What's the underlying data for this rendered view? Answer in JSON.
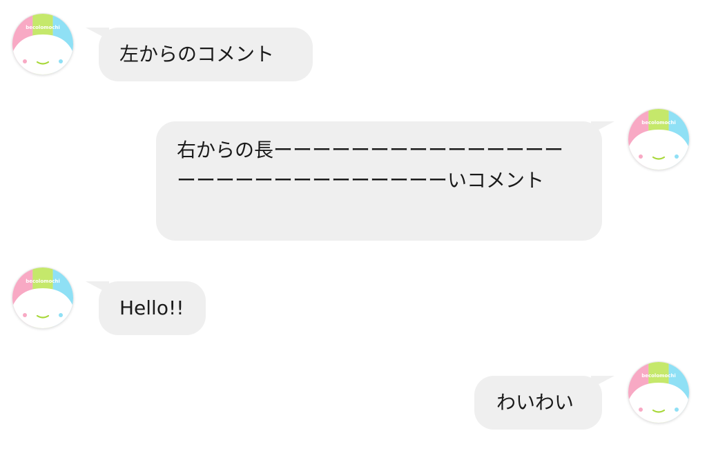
{
  "chat": {
    "avatar_text": "becolomochi",
    "avatar_icon": "becolomochi-mochi-face-icon",
    "colors": {
      "bubble": "#efefef",
      "avatar_pink": "#f8a9c4",
      "avatar_green": "#c5e86b",
      "avatar_blue": "#8fe0f5",
      "smile": "#a8d83a"
    },
    "messages": [
      {
        "side": "left",
        "text": "左からのコメント"
      },
      {
        "side": "right",
        "text": "右からの長ーーーーーーーーーーーーーーーーーーーーーーーーーーーーーいコメント"
      },
      {
        "side": "left",
        "text": "Hello!!"
      },
      {
        "side": "right",
        "text": "わいわい"
      }
    ]
  }
}
